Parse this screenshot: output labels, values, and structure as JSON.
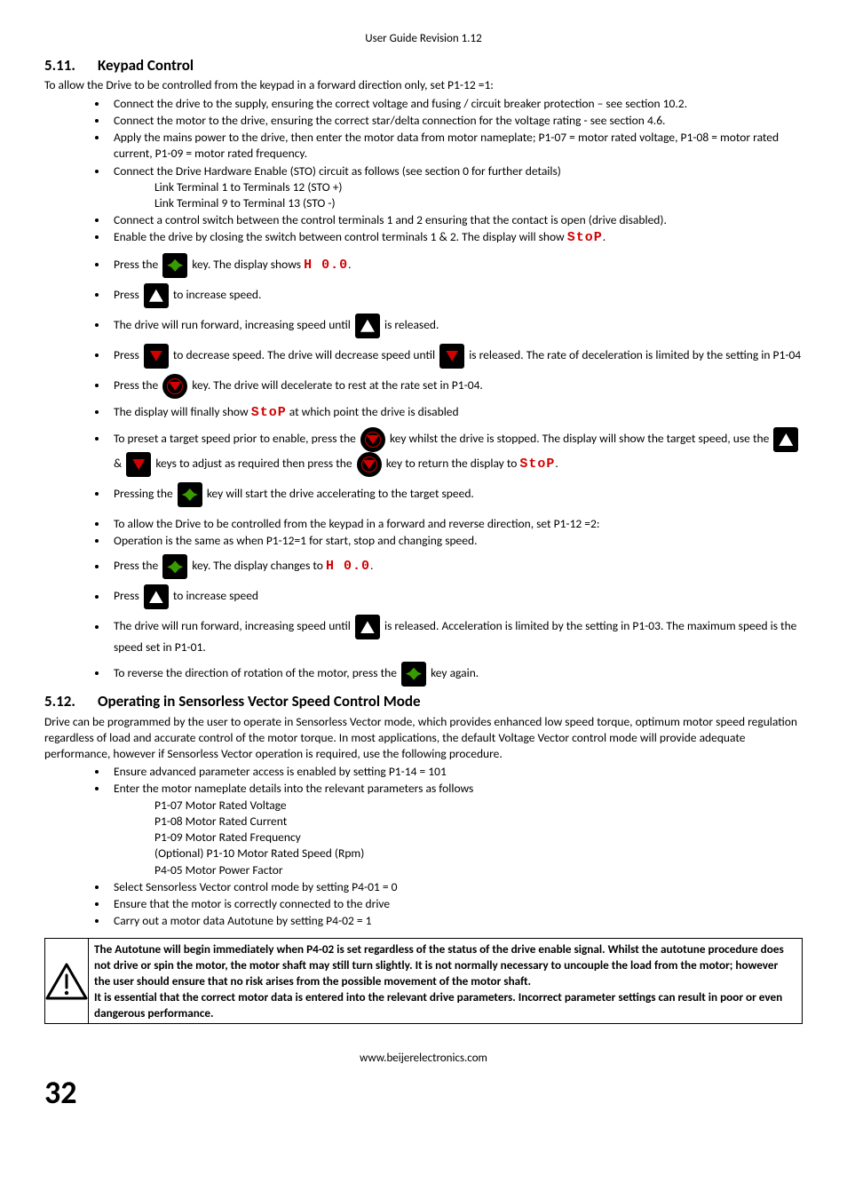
{
  "header": {
    "revision": "User Guide Revision 1.12"
  },
  "section511": {
    "number": "5.11.",
    "title": "Keypad Control",
    "intro": "To allow the Drive to be controlled from the keypad in a forward direction only, set P1-12 =1:",
    "b1": "Connect the drive to the supply, ensuring the correct voltage and fusing / circuit breaker protection – see section 10.2.",
    "b2": "Connect the motor to the drive, ensuring the correct star/delta connection for the voltage rating - see section 4.6.",
    "b3": "Apply the mains power to the drive, then enter the motor data from motor nameplate; P1-07 = motor rated voltage, P1-08 = motor rated current, P1-09 = motor rated frequency.",
    "b4": "Connect the Drive Hardware Enable (STO) circuit as follows (see section 0 for further details)",
    "b4s1": "Link Terminal 1 to Terminals 12 (STO +)",
    "b4s2": "Link Terminal 9 to Terminal 13 (STO -)",
    "b5": "Connect a control switch between the control terminals 1 and 2 ensuring that the contact is open (drive disabled).",
    "b6a": "Enable the drive by closing the switch between control terminals 1 & 2. The display will show ",
    "b6seg": "StoP",
    "b6b": ".",
    "b7a": "Press the ",
    "b7b": " key. The display shows ",
    "b7seg": "H  0.0",
    "b7c": ".",
    "b8a": "Press ",
    "b8b": " to increase speed.",
    "b9a": "The drive will run forward, increasing speed until ",
    "b9b": " is released.",
    "b10a": "Press ",
    "b10b": " to decrease speed. The drive will decrease speed until ",
    "b10c": " is released. The rate of deceleration is limited by the setting in P1-04",
    "b11a": "Press the ",
    "b11b": " key. The drive will decelerate to rest at the rate set in P1-04.",
    "b12a": "The display will finally show ",
    "b12seg": "StoP",
    "b12b": " at which point the drive is disabled",
    "b13a": "To preset a target speed prior to enable, press the ",
    "b13b": " key whilst the drive is stopped. The display will show the target speed, use the ",
    "b13c": " & ",
    "b13d": " keys to adjust as required then press the ",
    "b13e": " key to return the display to ",
    "b13seg": "StoP",
    "b13f": ".",
    "b14a": "Pressing the ",
    "b14b": " key will start the drive accelerating to the target speed.",
    "b15": "To allow the Drive to be controlled from the keypad in a forward and reverse direction, set P1-12 =2:",
    "b16": "Operation is the same as when P1-12=1 for start, stop and changing speed.",
    "b17a": "Press the ",
    "b17b": " key. The display changes to ",
    "b17seg": "H  0.0",
    "b17c": ".",
    "b18a": "Press ",
    "b18b": " to increase speed",
    "b19a": "The drive will run forward, increasing speed until ",
    "b19b": " is released. Acceleration is limited by the setting in P1-03. The maximum speed is the speed set in P1-01.",
    "b20a": "To reverse the direction of rotation of the motor, press the ",
    "b20b": " key again."
  },
  "section512": {
    "number": "5.12.",
    "title": "Operating in Sensorless Vector Speed Control Mode",
    "intro": "Drive can be programmed by the user to operate in Sensorless Vector mode, which provides enhanced low speed torque, optimum motor speed regulation regardless of load and accurate control of the motor torque. In most applications, the default Voltage Vector control mode will provide adequate performance, however if Sensorless Vector operation is required, use the following procedure.",
    "b1": "Ensure advanced parameter access is enabled by setting P1-14 = 101",
    "b2": "Enter the motor nameplate details into the relevant parameters as follows",
    "b2s1": "P1-07 Motor Rated Voltage",
    "b2s2": "P1-08 Motor Rated Current",
    "b2s3": "P1-09 Motor Rated Frequency",
    "b2s4": "(Optional) P1-10 Motor Rated Speed (Rpm)",
    "b2s5": "P4-05 Motor Power Factor",
    "b3": "Select Sensorless Vector control mode by setting P4-01 = 0",
    "b4": "Ensure that the motor is correctly connected to the drive",
    "b5": "Carry out a motor data Autotune by setting P4-02 = 1"
  },
  "warning": {
    "p1": "The Autotune will begin immediately when P4-02 is set regardless of the status of the drive enable signal. Whilst the autotune procedure does not drive or spin the motor, the motor shaft may still turn slightly. It is not normally necessary to uncouple the load from the motor; however the user should ensure that no risk arises from the possible movement of the motor shaft.",
    "p2": "It is essential that the correct motor data is entered into the relevant drive parameters. Incorrect parameter settings can result in poor or even dangerous performance."
  },
  "footer": {
    "url": "www.beijerelectronics.com",
    "page": "32"
  }
}
